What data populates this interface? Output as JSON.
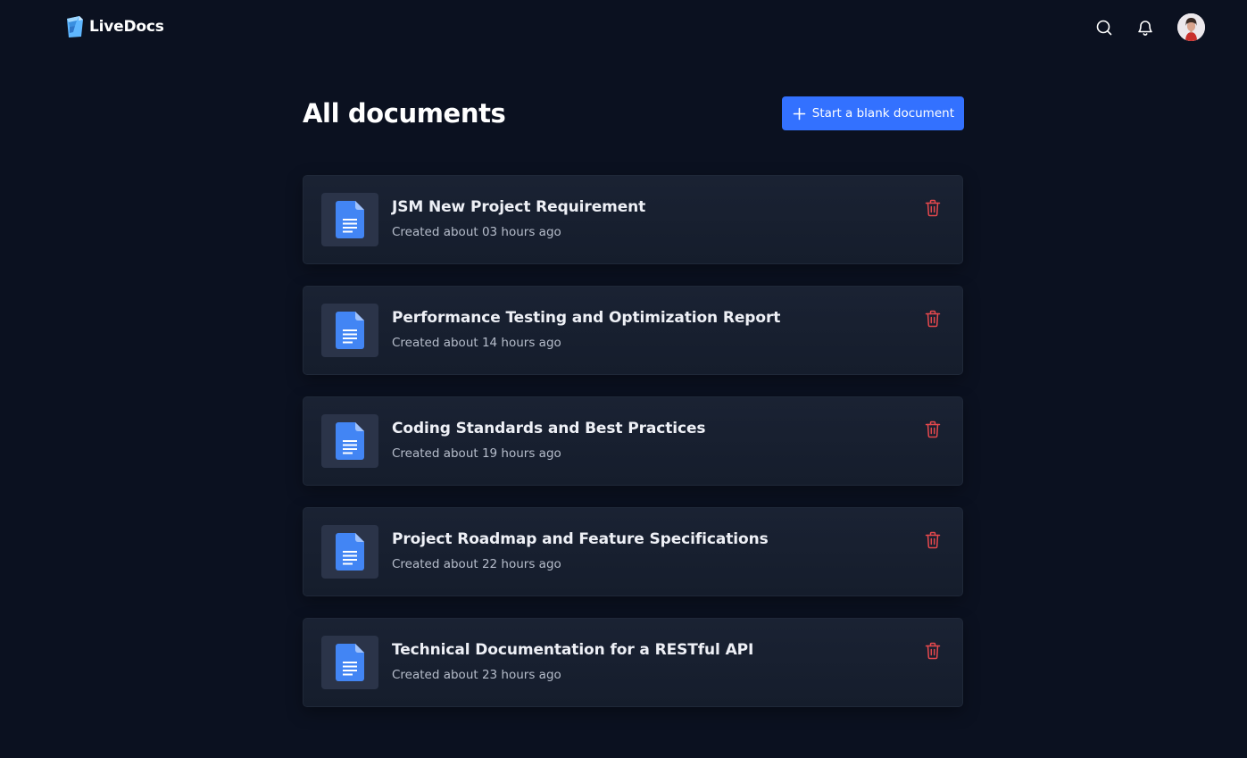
{
  "app": {
    "name": "LiveDocs"
  },
  "header": {
    "icons": [
      "search-icon",
      "bell-icon"
    ],
    "avatar": "user-avatar"
  },
  "main": {
    "title": "All documents",
    "new_button_label": "Start a blank document"
  },
  "documents": [
    {
      "title": "JSM New Project Requirement",
      "created": "Created about 03 hours ago"
    },
    {
      "title": "Performance Testing and Optimization Report",
      "created": "Created about 14 hours ago"
    },
    {
      "title": "Coding Standards and Best Practices",
      "created": "Created about 19 hours ago"
    },
    {
      "title": "Project Roadmap and Feature Specifications",
      "created": "Created about 22 hours ago"
    },
    {
      "title": "Technical Documentation for a RESTful API",
      "created": "Created about 23 hours ago"
    }
  ],
  "colors": {
    "background": "#0b1120",
    "accent": "#3371ff",
    "card": "#1a2233",
    "delete": "#e5484d",
    "doc_icon": "#4285f4"
  }
}
